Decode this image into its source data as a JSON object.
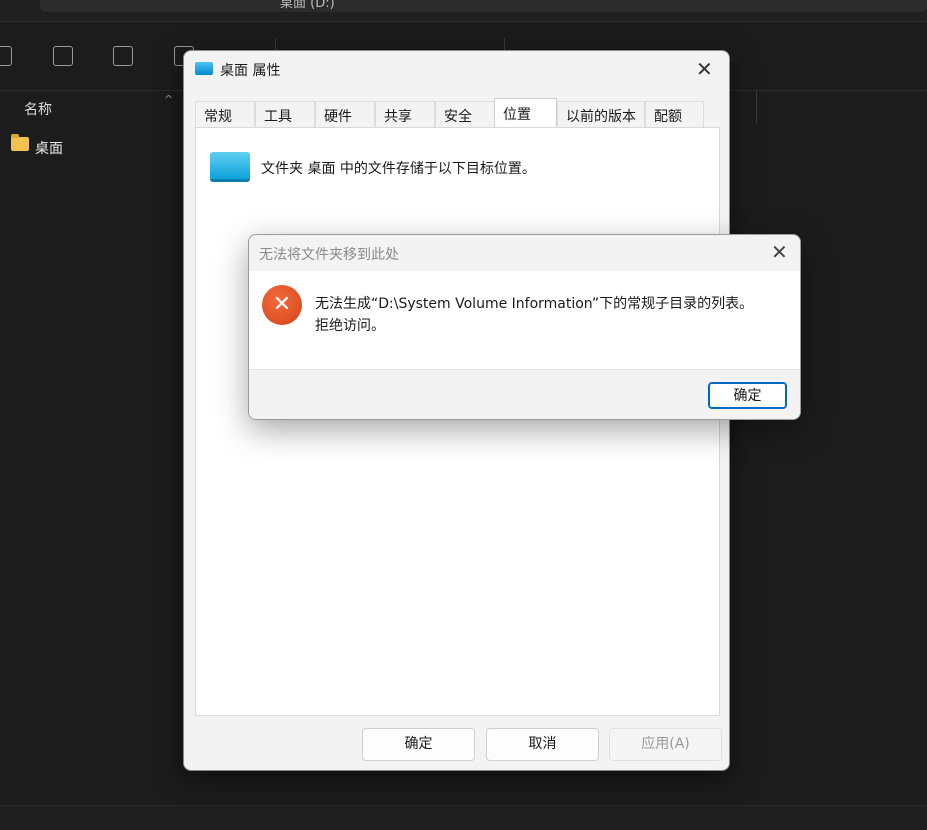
{
  "explorer": {
    "address_text": "桌面 (D:)",
    "column_name": "名称",
    "sort_caret": "^",
    "items": [
      {
        "label": "桌面",
        "icon": "folder-icon"
      }
    ]
  },
  "properties": {
    "title": "桌面 属性",
    "close_glyph": "✕",
    "tabs": [
      {
        "label": "常规"
      },
      {
        "label": "工具"
      },
      {
        "label": "硬件"
      },
      {
        "label": "共享"
      },
      {
        "label": "安全"
      },
      {
        "label": "位置",
        "active": true
      },
      {
        "label": "以前的版本"
      },
      {
        "label": "配额"
      }
    ],
    "panel_text": "文件夹 桌面 中的文件存储于以下目标位置。",
    "buttons": {
      "ok": "确定",
      "cancel": "取消",
      "apply": "应用(A)"
    }
  },
  "error_dialog": {
    "title": "无法将文件夹移到此处",
    "close_glyph": "✕",
    "icon_glyph": "✕",
    "message_line1": "无法生成“D:\\System Volume Information”下的常规子目录的列表。",
    "message_line2": "拒绝访问。",
    "ok": "确定"
  },
  "colors": {
    "accent": "#0067c0",
    "error": "#d4441a",
    "explorer_bg": "#1c1c1c"
  }
}
